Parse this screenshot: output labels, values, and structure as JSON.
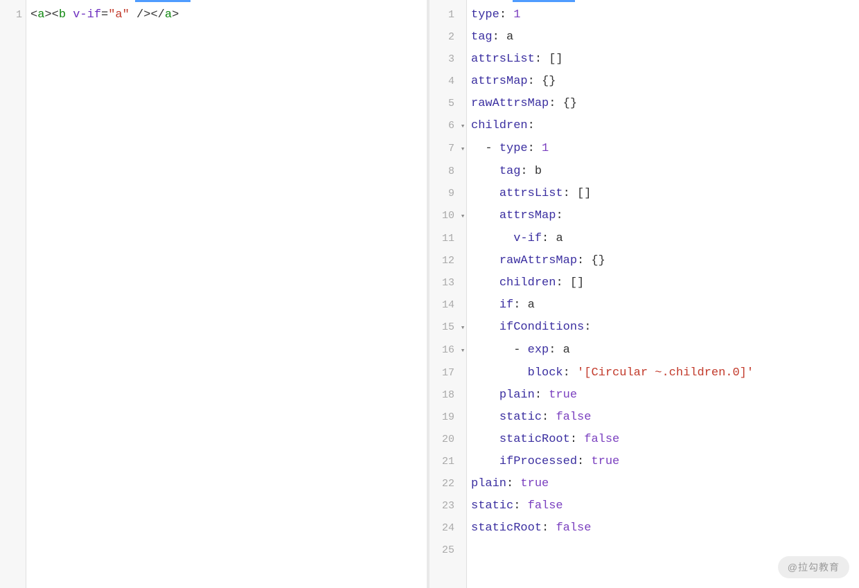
{
  "watermark": "@拉勾教育",
  "left": {
    "lines": [
      {
        "num": "1",
        "fold": "",
        "tokens": [
          {
            "cls": "punct",
            "t": "<"
          },
          {
            "cls": "tag",
            "t": "a"
          },
          {
            "cls": "punct",
            "t": ">"
          },
          {
            "cls": "punct",
            "t": "<"
          },
          {
            "cls": "tag",
            "t": "b"
          },
          {
            "cls": "plain",
            "t": " "
          },
          {
            "cls": "attr",
            "t": "v-if"
          },
          {
            "cls": "punct",
            "t": "="
          },
          {
            "cls": "str",
            "t": "\"a\""
          },
          {
            "cls": "plain",
            "t": " "
          },
          {
            "cls": "punct",
            "t": "/>"
          },
          {
            "cls": "punct",
            "t": "</"
          },
          {
            "cls": "tag",
            "t": "a"
          },
          {
            "cls": "punct",
            "t": ">"
          }
        ]
      }
    ]
  },
  "right": {
    "lines": [
      {
        "num": "1",
        "fold": "",
        "tokens": [
          {
            "cls": "key",
            "t": "type"
          },
          {
            "cls": "punct",
            "t": ": "
          },
          {
            "cls": "num",
            "t": "1"
          }
        ]
      },
      {
        "num": "2",
        "fold": "",
        "tokens": [
          {
            "cls": "key",
            "t": "tag"
          },
          {
            "cls": "punct",
            "t": ": "
          },
          {
            "cls": "plain",
            "t": "a"
          }
        ]
      },
      {
        "num": "3",
        "fold": "",
        "tokens": [
          {
            "cls": "key",
            "t": "attrsList"
          },
          {
            "cls": "punct",
            "t": ": []"
          }
        ]
      },
      {
        "num": "4",
        "fold": "",
        "tokens": [
          {
            "cls": "key",
            "t": "attrsMap"
          },
          {
            "cls": "punct",
            "t": ": {}"
          }
        ]
      },
      {
        "num": "5",
        "fold": "",
        "tokens": [
          {
            "cls": "key",
            "t": "rawAttrsMap"
          },
          {
            "cls": "punct",
            "t": ": {}"
          }
        ]
      },
      {
        "num": "6",
        "fold": "▾",
        "tokens": [
          {
            "cls": "key",
            "t": "children"
          },
          {
            "cls": "punct",
            "t": ":"
          }
        ]
      },
      {
        "num": "7",
        "fold": "▾",
        "tokens": [
          {
            "cls": "plain",
            "t": "  "
          },
          {
            "cls": "dash",
            "t": "- "
          },
          {
            "cls": "key",
            "t": "type"
          },
          {
            "cls": "punct",
            "t": ": "
          },
          {
            "cls": "num",
            "t": "1"
          }
        ]
      },
      {
        "num": "8",
        "fold": "",
        "tokens": [
          {
            "cls": "plain",
            "t": "    "
          },
          {
            "cls": "key",
            "t": "tag"
          },
          {
            "cls": "punct",
            "t": ": "
          },
          {
            "cls": "plain",
            "t": "b"
          }
        ]
      },
      {
        "num": "9",
        "fold": "",
        "tokens": [
          {
            "cls": "plain",
            "t": "    "
          },
          {
            "cls": "key",
            "t": "attrsList"
          },
          {
            "cls": "punct",
            "t": ": []"
          }
        ]
      },
      {
        "num": "10",
        "fold": "▾",
        "tokens": [
          {
            "cls": "plain",
            "t": "    "
          },
          {
            "cls": "key",
            "t": "attrsMap"
          },
          {
            "cls": "punct",
            "t": ":"
          }
        ]
      },
      {
        "num": "11",
        "fold": "",
        "tokens": [
          {
            "cls": "plain",
            "t": "      "
          },
          {
            "cls": "key",
            "t": "v-if"
          },
          {
            "cls": "punct",
            "t": ": "
          },
          {
            "cls": "plain",
            "t": "a"
          }
        ]
      },
      {
        "num": "12",
        "fold": "",
        "tokens": [
          {
            "cls": "plain",
            "t": "    "
          },
          {
            "cls": "key",
            "t": "rawAttrsMap"
          },
          {
            "cls": "punct",
            "t": ": {}"
          }
        ]
      },
      {
        "num": "13",
        "fold": "",
        "tokens": [
          {
            "cls": "plain",
            "t": "    "
          },
          {
            "cls": "key",
            "t": "children"
          },
          {
            "cls": "punct",
            "t": ": []"
          }
        ]
      },
      {
        "num": "14",
        "fold": "",
        "tokens": [
          {
            "cls": "plain",
            "t": "    "
          },
          {
            "cls": "key",
            "t": "if"
          },
          {
            "cls": "punct",
            "t": ": "
          },
          {
            "cls": "plain",
            "t": "a"
          }
        ]
      },
      {
        "num": "15",
        "fold": "▾",
        "tokens": [
          {
            "cls": "plain",
            "t": "    "
          },
          {
            "cls": "key",
            "t": "ifConditions"
          },
          {
            "cls": "punct",
            "t": ":"
          }
        ]
      },
      {
        "num": "16",
        "fold": "▾",
        "tokens": [
          {
            "cls": "plain",
            "t": "      "
          },
          {
            "cls": "dash",
            "t": "- "
          },
          {
            "cls": "key",
            "t": "exp"
          },
          {
            "cls": "punct",
            "t": ": "
          },
          {
            "cls": "plain",
            "t": "a"
          }
        ]
      },
      {
        "num": "17",
        "fold": "",
        "tokens": [
          {
            "cls": "plain",
            "t": "        "
          },
          {
            "cls": "key",
            "t": "block"
          },
          {
            "cls": "punct",
            "t": ": "
          },
          {
            "cls": "str",
            "t": "'[Circular ~.children.0]'"
          }
        ]
      },
      {
        "num": "18",
        "fold": "",
        "tokens": [
          {
            "cls": "plain",
            "t": "    "
          },
          {
            "cls": "key",
            "t": "plain"
          },
          {
            "cls": "punct",
            "t": ": "
          },
          {
            "cls": "bool",
            "t": "true"
          }
        ]
      },
      {
        "num": "19",
        "fold": "",
        "tokens": [
          {
            "cls": "plain",
            "t": "    "
          },
          {
            "cls": "key",
            "t": "static"
          },
          {
            "cls": "punct",
            "t": ": "
          },
          {
            "cls": "bool",
            "t": "false"
          }
        ]
      },
      {
        "num": "20",
        "fold": "",
        "tokens": [
          {
            "cls": "plain",
            "t": "    "
          },
          {
            "cls": "key",
            "t": "staticRoot"
          },
          {
            "cls": "punct",
            "t": ": "
          },
          {
            "cls": "bool",
            "t": "false"
          }
        ]
      },
      {
        "num": "21",
        "fold": "",
        "tokens": [
          {
            "cls": "plain",
            "t": "    "
          },
          {
            "cls": "key",
            "t": "ifProcessed"
          },
          {
            "cls": "punct",
            "t": ": "
          },
          {
            "cls": "bool",
            "t": "true"
          }
        ]
      },
      {
        "num": "22",
        "fold": "",
        "tokens": [
          {
            "cls": "key",
            "t": "plain"
          },
          {
            "cls": "punct",
            "t": ": "
          },
          {
            "cls": "bool",
            "t": "true"
          }
        ]
      },
      {
        "num": "23",
        "fold": "",
        "tokens": [
          {
            "cls": "key",
            "t": "static"
          },
          {
            "cls": "punct",
            "t": ": "
          },
          {
            "cls": "bool",
            "t": "false"
          }
        ]
      },
      {
        "num": "24",
        "fold": "",
        "tokens": [
          {
            "cls": "key",
            "t": "staticRoot"
          },
          {
            "cls": "punct",
            "t": ": "
          },
          {
            "cls": "bool",
            "t": "false"
          }
        ]
      },
      {
        "num": "25",
        "fold": "",
        "tokens": []
      }
    ]
  }
}
